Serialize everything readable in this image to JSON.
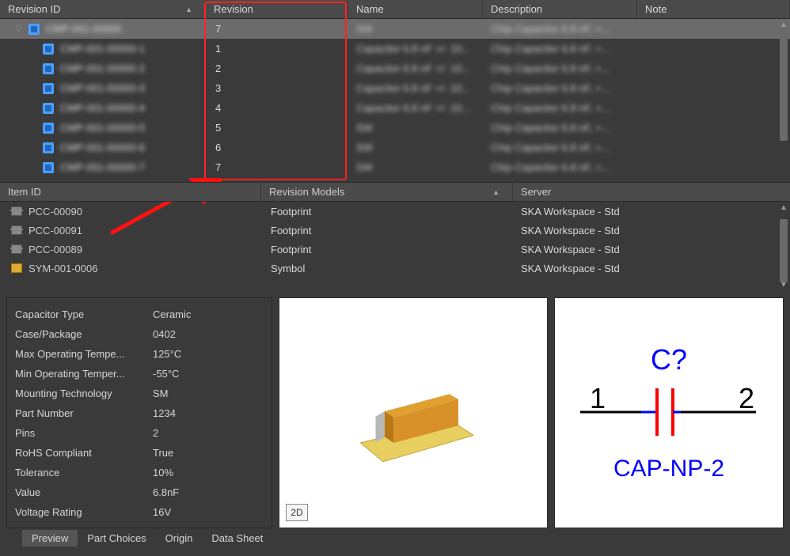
{
  "top": {
    "headers": {
      "revid": "Revision ID",
      "revision": "Revision",
      "name": "Name",
      "description": "Description",
      "note": "Note"
    },
    "rows": [
      {
        "id": "CMP-001-00000",
        "rev": "7",
        "name": "SW",
        "desc": "Chip Capacitor 6.8 nF, +...",
        "selected": true,
        "child": false
      },
      {
        "id": "CMP-001-00000-1",
        "rev": "1",
        "name": "Capacitor 6.8 nF +/- 10...",
        "desc": "Chip Capacitor 6.8 nF, +...",
        "selected": false,
        "child": true
      },
      {
        "id": "CMP-001-00000-2",
        "rev": "2",
        "name": "Capacitor 6.8 nF +/- 10...",
        "desc": "Chip Capacitor 6.8 nF, +...",
        "selected": false,
        "child": true
      },
      {
        "id": "CMP-001-00000-3",
        "rev": "3",
        "name": "Capacitor 6.8 nF +/- 10...",
        "desc": "Chip Capacitor 6.8 nF, +...",
        "selected": false,
        "child": true
      },
      {
        "id": "CMP-001-00000-4",
        "rev": "4",
        "name": "Capacitor 6.8 nF +/- 10...",
        "desc": "Chip Capacitor 6.8 nF, +...",
        "selected": false,
        "child": true
      },
      {
        "id": "CMP-001-00000-5",
        "rev": "5",
        "name": "SW",
        "desc": "Chip Capacitor 6.8 nF, +...",
        "selected": false,
        "child": true
      },
      {
        "id": "CMP-001-00000-6",
        "rev": "6",
        "name": "SW",
        "desc": "Chip Capacitor 6.8 nF, +...",
        "selected": false,
        "child": true
      },
      {
        "id": "CMP-001-00000-7",
        "rev": "7",
        "name": "SW",
        "desc": "Chip Capacitor 6.8 nF, +...",
        "selected": false,
        "child": true
      }
    ]
  },
  "mid": {
    "headers": {
      "item": "Item ID",
      "rev": "Revision Models",
      "server": "Server"
    },
    "rows": [
      {
        "item": "PCC-00090",
        "rev": "Footprint",
        "server": "SKA Workspace - Std",
        "icon": "fp"
      },
      {
        "item": "PCC-00091",
        "rev": "Footprint",
        "server": "SKA Workspace - Std",
        "icon": "fp"
      },
      {
        "item": "PCC-00089",
        "rev": "Footprint",
        "server": "SKA Workspace - Std",
        "icon": "fp"
      },
      {
        "item": "SYM-001-0006",
        "rev": "Symbol",
        "server": "SKA Workspace - Std",
        "icon": "sym"
      }
    ]
  },
  "props": {
    "rows": [
      {
        "k": "Capacitor Type",
        "v": "Ceramic"
      },
      {
        "k": "Case/Package",
        "v": "0402"
      },
      {
        "k": "Max Operating Tempe...",
        "v": "125°C"
      },
      {
        "k": "Min Operating Temper...",
        "v": "-55°C"
      },
      {
        "k": "Mounting Technology",
        "v": "SM"
      },
      {
        "k": "Part Number",
        "v": "1234"
      },
      {
        "k": "Pins",
        "v": "2"
      },
      {
        "k": "RoHS Compliant",
        "v": "True"
      },
      {
        "k": "Tolerance",
        "v": "10%"
      },
      {
        "k": "Value",
        "v": "6.8nF"
      },
      {
        "k": "Voltage Rating",
        "v": "16V"
      }
    ]
  },
  "preview": {
    "btn2d": "2D"
  },
  "symbol": {
    "designator": "C?",
    "pin1": "1",
    "pin2": "2",
    "name": "CAP-NP-2"
  },
  "tabs": {
    "items": [
      "Preview",
      "Part Choices",
      "Origin",
      "Data Sheet"
    ],
    "active": 0
  }
}
